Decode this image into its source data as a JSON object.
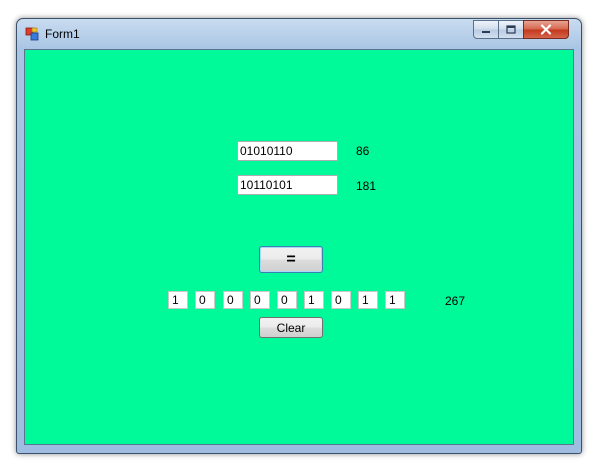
{
  "window": {
    "title": "Form1",
    "icon": "winforms-app-icon",
    "controls": {
      "minimize": "minimize-icon",
      "maximize": "maximize-icon",
      "close": "close-icon"
    }
  },
  "form": {
    "background_color": "#00fa9a",
    "input1": {
      "value": "01010110",
      "decimal": "86"
    },
    "input2": {
      "value": "10110101",
      "decimal": "181"
    },
    "equals_label": "=",
    "result_bits": [
      "1",
      "0",
      "0",
      "0",
      "0",
      "1",
      "0",
      "1",
      "1"
    ],
    "result_decimal": "267",
    "clear_label": "Clear"
  }
}
